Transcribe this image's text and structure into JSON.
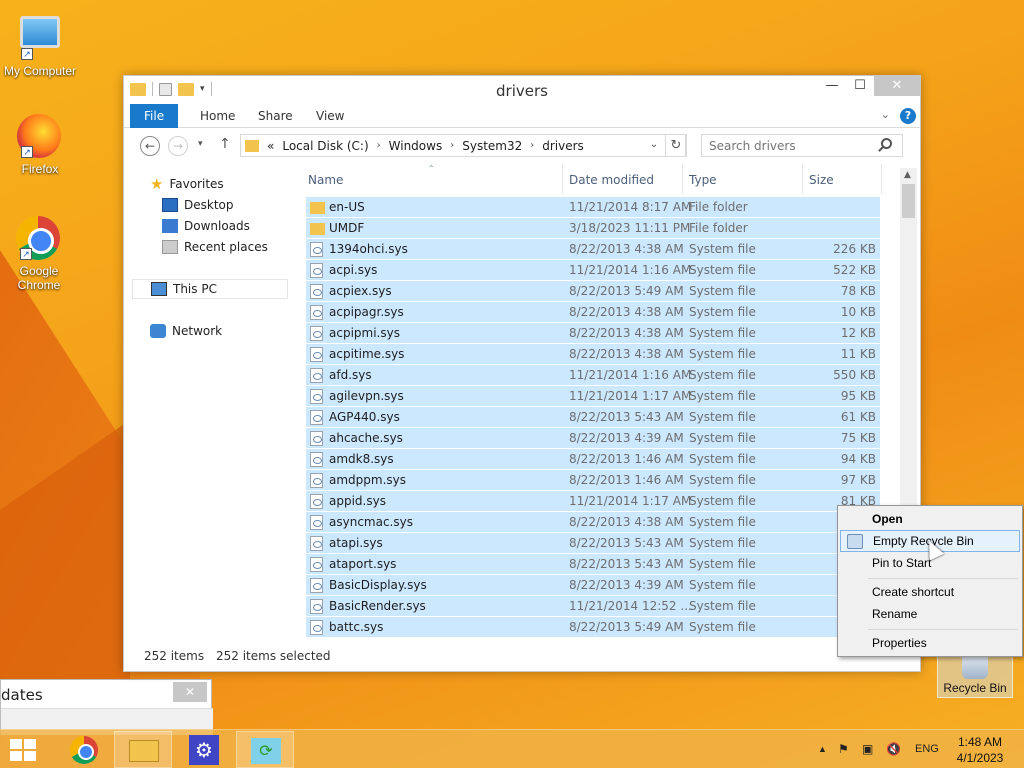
{
  "desktop": {
    "icons": [
      {
        "label": "My Computer"
      },
      {
        "label": "Firefox"
      },
      {
        "label": "Google Chrome"
      }
    ],
    "recycle_bin": "Recycle Bin"
  },
  "window": {
    "title": "drivers",
    "ribbon": {
      "file": "File",
      "home": "Home",
      "share": "Share",
      "view": "View"
    },
    "address": {
      "prefix": "«",
      "crumbs": [
        "Local Disk (C:)",
        "Windows",
        "System32",
        "drivers"
      ]
    },
    "search_placeholder": "Search drivers",
    "nav": {
      "favorites": "Favorites",
      "desktop": "Desktop",
      "downloads": "Downloads",
      "recent": "Recent places",
      "this_pc": "This PC",
      "network": "Network"
    },
    "columns": {
      "name": "Name",
      "date": "Date modified",
      "type": "Type",
      "size": "Size"
    },
    "files": [
      {
        "name": "en-US",
        "date": "11/21/2014 8:17 AM",
        "type": "File folder",
        "size": "",
        "kind": "folder"
      },
      {
        "name": "UMDF",
        "date": "3/18/2023 11:11 PM",
        "type": "File folder",
        "size": "",
        "kind": "folder"
      },
      {
        "name": "1394ohci.sys",
        "date": "8/22/2013 4:38 AM",
        "type": "System file",
        "size": "226 KB",
        "kind": "sys"
      },
      {
        "name": "acpi.sys",
        "date": "11/21/2014 1:16 AM",
        "type": "System file",
        "size": "522 KB",
        "kind": "sys"
      },
      {
        "name": "acpiex.sys",
        "date": "8/22/2013 5:49 AM",
        "type": "System file",
        "size": "78 KB",
        "kind": "sys"
      },
      {
        "name": "acpipagr.sys",
        "date": "8/22/2013 4:38 AM",
        "type": "System file",
        "size": "10 KB",
        "kind": "sys"
      },
      {
        "name": "acpipmi.sys",
        "date": "8/22/2013 4:38 AM",
        "type": "System file",
        "size": "12 KB",
        "kind": "sys"
      },
      {
        "name": "acpitime.sys",
        "date": "8/22/2013 4:38 AM",
        "type": "System file",
        "size": "11 KB",
        "kind": "sys"
      },
      {
        "name": "afd.sys",
        "date": "11/21/2014 1:16 AM",
        "type": "System file",
        "size": "550 KB",
        "kind": "sys"
      },
      {
        "name": "agilevpn.sys",
        "date": "11/21/2014 1:17 AM",
        "type": "System file",
        "size": "95 KB",
        "kind": "sys"
      },
      {
        "name": "AGP440.sys",
        "date": "8/22/2013 5:43 AM",
        "type": "System file",
        "size": "61 KB",
        "kind": "sys"
      },
      {
        "name": "ahcache.sys",
        "date": "8/22/2013 4:39 AM",
        "type": "System file",
        "size": "75 KB",
        "kind": "sys"
      },
      {
        "name": "amdk8.sys",
        "date": "8/22/2013 1:46 AM",
        "type": "System file",
        "size": "94 KB",
        "kind": "sys"
      },
      {
        "name": "amdppm.sys",
        "date": "8/22/2013 1:46 AM",
        "type": "System file",
        "size": "97 KB",
        "kind": "sys"
      },
      {
        "name": "appid.sys",
        "date": "11/21/2014 1:17 AM",
        "type": "System file",
        "size": "81 KB",
        "kind": "sys"
      },
      {
        "name": "asyncmac.sys",
        "date": "8/22/2013 4:38 AM",
        "type": "System file",
        "size": "",
        "kind": "sys"
      },
      {
        "name": "atapi.sys",
        "date": "8/22/2013 5:43 AM",
        "type": "System file",
        "size": "",
        "kind": "sys"
      },
      {
        "name": "ataport.sys",
        "date": "8/22/2013 5:43 AM",
        "type": "System file",
        "size": "",
        "kind": "sys"
      },
      {
        "name": "BasicDisplay.sys",
        "date": "8/22/2013 4:39 AM",
        "type": "System file",
        "size": "",
        "kind": "sys"
      },
      {
        "name": "BasicRender.sys",
        "date": "11/21/2014 12:52 ...",
        "type": "System file",
        "size": "",
        "kind": "sys"
      },
      {
        "name": "battc.sys",
        "date": "8/22/2013 5:49 AM",
        "type": "System file",
        "size": "",
        "kind": "sys"
      }
    ],
    "status": {
      "count": "252 items",
      "selected": "252 items selected"
    }
  },
  "context_menu": {
    "open": "Open",
    "empty": "Empty Recycle Bin",
    "pin": "Pin to Start",
    "shortcut": "Create shortcut",
    "rename": "Rename",
    "properties": "Properties"
  },
  "updates_window": {
    "title": "dates"
  },
  "taskbar": {
    "language": "ENG",
    "time": "1:48 AM",
    "date": "4/1/2023"
  },
  "colors": {
    "accent": "#1979ca",
    "selection": "#cce8ff"
  }
}
